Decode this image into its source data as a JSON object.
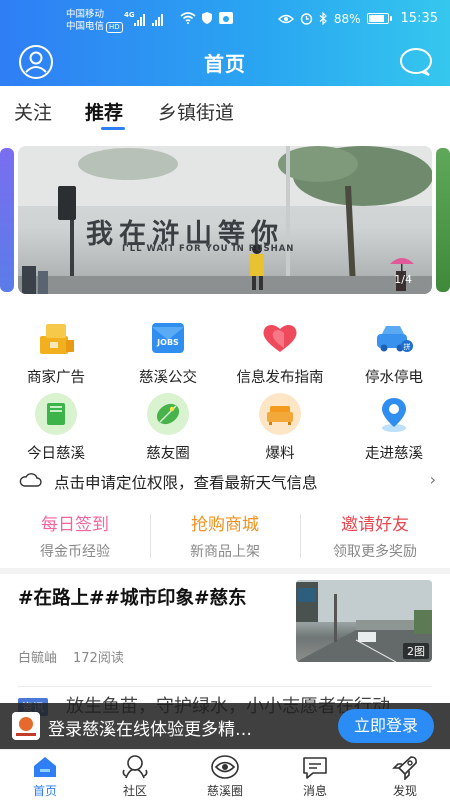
{
  "status_bar": {
    "carrier1": "中国移动",
    "carrier2": "中国电信",
    "hd_label": "HD",
    "net_label": "4G",
    "battery_text": "88%",
    "time": "15:35",
    "battery_level": 0.88
  },
  "header": {
    "title": "首页"
  },
  "tabs": [
    {
      "label": "关注"
    },
    {
      "label": "推荐"
    },
    {
      "label": "乡镇街道"
    }
  ],
  "banner": {
    "headline": "我在浒山等你",
    "subline": "I'LL WAIT FOR YOU IN FUSHAN",
    "index": "1/4"
  },
  "grid": [
    {
      "label": "商家广告",
      "icon": "shop-ad-icon"
    },
    {
      "label": "慈溪公交",
      "icon": "bus-jobs-icon"
    },
    {
      "label": "信息发布指南",
      "icon": "heart-info-icon"
    },
    {
      "label": "停水停电",
      "icon": "car-pin-icon"
    },
    {
      "label": "今日慈溪",
      "icon": "book-icon"
    },
    {
      "label": "慈友圈",
      "icon": "leaf-circle-icon"
    },
    {
      "label": "爆料",
      "icon": "sofa-icon"
    },
    {
      "label": "走进慈溪",
      "icon": "location-pin-icon"
    }
  ],
  "weather": {
    "text": "点击申请定位权限，查看最新天气信息"
  },
  "promos": [
    {
      "title": "每日签到",
      "sub": "得金币经验",
      "color": "#f266a0"
    },
    {
      "title": "抢购商城",
      "sub": "新商品上架",
      "color": "#f0921e"
    },
    {
      "title": "邀请好友",
      "sub": "领取更多奖励",
      "color": "#e8484f"
    }
  ],
  "news": {
    "headline": "#在路上##城市印象#慈东",
    "author": "白毓岫",
    "reads": "172阅读",
    "image_count": "2图"
  },
  "next_item": {
    "tag": "资讯",
    "title": "放生鱼苗，守护绿水，小小志愿者在行动"
  },
  "login_bar": {
    "text": "登录慈溪在线体验更多精…",
    "button": "立即登录"
  },
  "bottom_nav": [
    {
      "label": "首页"
    },
    {
      "label": "社区"
    },
    {
      "label": "慈溪圈"
    },
    {
      "label": "消息"
    },
    {
      "label": "发现"
    }
  ]
}
